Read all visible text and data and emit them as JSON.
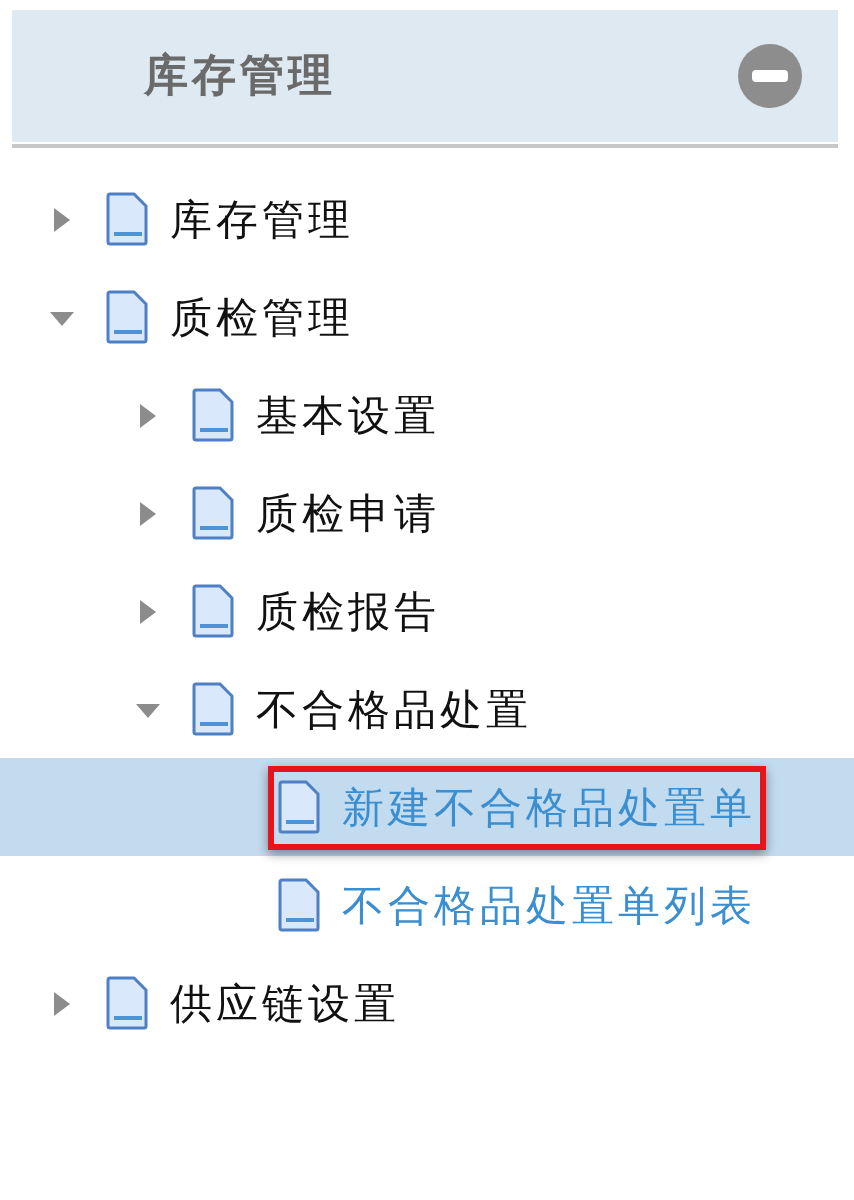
{
  "panel": {
    "title": "库存管理",
    "collapsed": false
  },
  "tree": [
    {
      "label": "库存管理",
      "kind": "folder",
      "expanded": false,
      "selected": false,
      "highlighted": false
    },
    {
      "label": "质检管理",
      "kind": "folder",
      "expanded": true,
      "selected": false,
      "highlighted": false,
      "children": [
        {
          "label": "基本设置",
          "kind": "folder",
          "expanded": false,
          "selected": false,
          "highlighted": false
        },
        {
          "label": "质检申请",
          "kind": "folder",
          "expanded": false,
          "selected": false,
          "highlighted": false
        },
        {
          "label": "质检报告",
          "kind": "folder",
          "expanded": false,
          "selected": false,
          "highlighted": false
        },
        {
          "label": "不合格品处置",
          "kind": "folder",
          "expanded": true,
          "selected": false,
          "highlighted": false,
          "children": [
            {
              "label": "新建不合格品处置单",
              "kind": "leaf",
              "selected": true,
              "highlighted": true
            },
            {
              "label": "不合格品处置单列表",
              "kind": "leaf",
              "selected": false,
              "highlighted": false
            }
          ]
        }
      ]
    },
    {
      "label": "供应链设置",
      "kind": "folder",
      "expanded": false,
      "selected": false,
      "highlighted": false
    }
  ]
}
